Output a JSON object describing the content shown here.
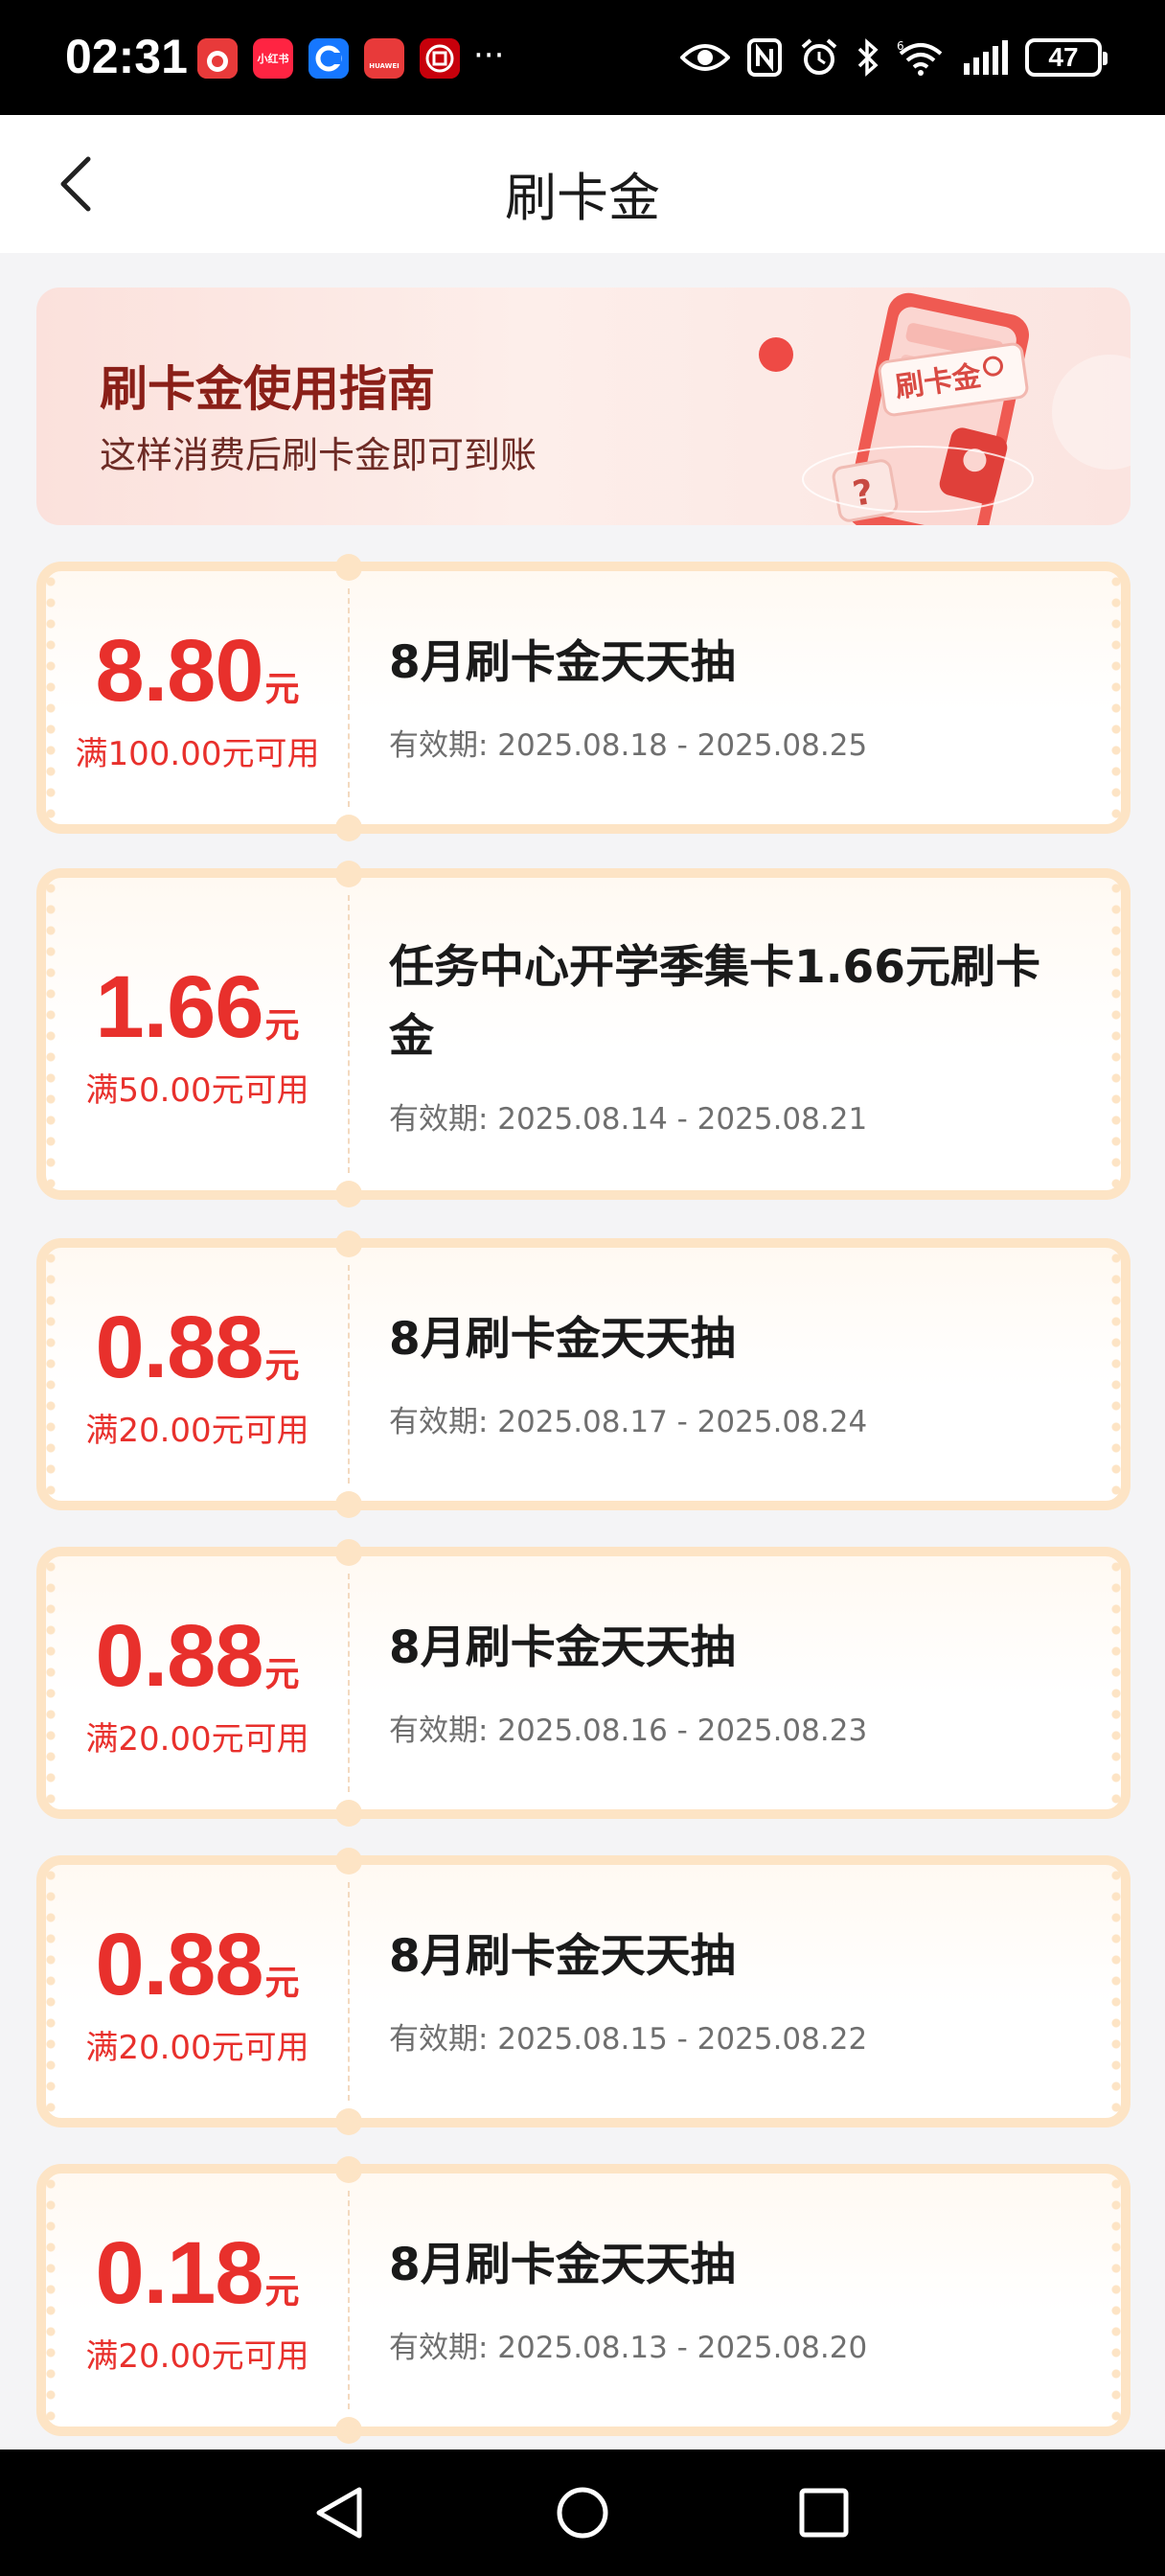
{
  "status_bar": {
    "time": "02:31",
    "apps": [
      {
        "name": "app-icon-1",
        "label": "",
        "color": "#e83a3a"
      },
      {
        "name": "app-icon-xiaohongshu",
        "label": "小红书",
        "color": "#ff2442"
      },
      {
        "name": "app-icon-3",
        "label": "",
        "color": "#1677ff"
      },
      {
        "name": "app-icon-huawei",
        "label": "HUAWEI",
        "color": "#e83a3a"
      },
      {
        "name": "app-icon-icbc",
        "label": "",
        "color": "#c7000b"
      }
    ],
    "more": "···",
    "battery": "47"
  },
  "header": {
    "title": "刷卡金"
  },
  "guide": {
    "title": "刷卡金使用指南",
    "subtitle": "这样消费后刷卡金即可到账",
    "illustration_label": "刷卡金"
  },
  "coupons": [
    {
      "amount": "8.80",
      "unit": "元",
      "condition": "满100.00元可用",
      "title": "8月刷卡金天天抽",
      "validity": "有效期: 2025.08.18 - 2025.08.25"
    },
    {
      "amount": "1.66",
      "unit": "元",
      "condition": "满50.00元可用",
      "title": "任务中心开学季集卡1.66元刷卡金",
      "validity": "有效期: 2025.08.14 - 2025.08.21"
    },
    {
      "amount": "0.88",
      "unit": "元",
      "condition": "满20.00元可用",
      "title": "8月刷卡金天天抽",
      "validity": "有效期: 2025.08.17 - 2025.08.24"
    },
    {
      "amount": "0.88",
      "unit": "元",
      "condition": "满20.00元可用",
      "title": "8月刷卡金天天抽",
      "validity": "有效期: 2025.08.16 - 2025.08.23"
    },
    {
      "amount": "0.88",
      "unit": "元",
      "condition": "满20.00元可用",
      "title": "8月刷卡金天天抽",
      "validity": "有效期: 2025.08.15 - 2025.08.22"
    },
    {
      "amount": "0.18",
      "unit": "元",
      "condition": "满20.00元可用",
      "title": "8月刷卡金天天抽",
      "validity": "有效期: 2025.08.13 - 2025.08.20"
    }
  ],
  "colors": {
    "accent_red": "#e8302c",
    "coupon_border": "#fde4c5",
    "banner_title": "#8a1f18"
  }
}
